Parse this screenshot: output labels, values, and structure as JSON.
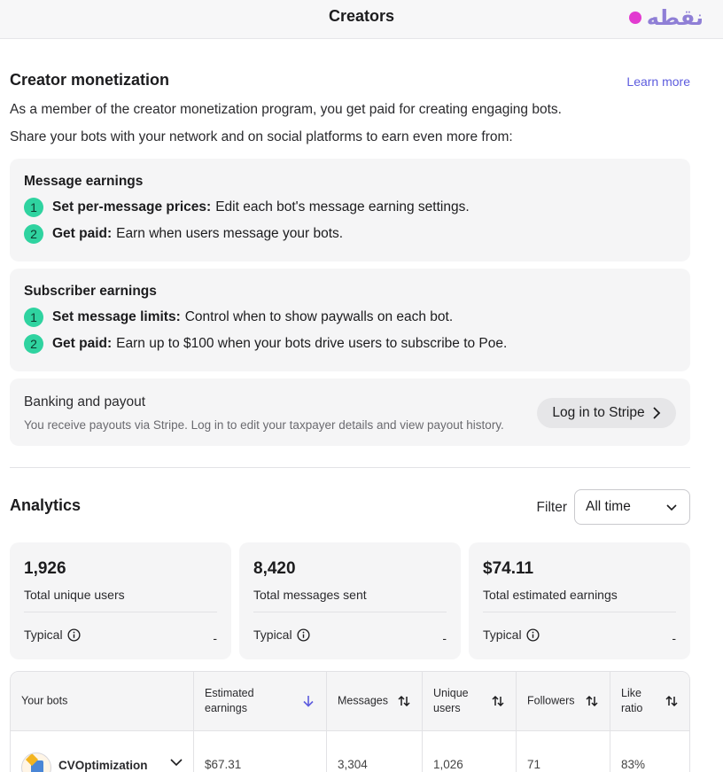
{
  "header": {
    "title": "Creators",
    "watermark": "نقطه"
  },
  "monetization": {
    "title": "Creator monetization",
    "learn_more": "Learn more",
    "intro_1": "As a member of the creator monetization program, you get paid for creating engaging bots.",
    "intro_2": "Share your bots with your network and on social platforms to earn even more from:",
    "message_earnings": {
      "title": "Message earnings",
      "steps": [
        {
          "num": "1",
          "bold": "Set per-message prices:",
          "text": "Edit each bot's message earning settings."
        },
        {
          "num": "2",
          "bold": "Get paid:",
          "text": "Earn when users message your bots."
        }
      ]
    },
    "subscriber_earnings": {
      "title": "Subscriber earnings",
      "steps": [
        {
          "num": "1",
          "bold": "Set message limits:",
          "text": "Control when to show paywalls on each bot."
        },
        {
          "num": "2",
          "bold": "Get paid:",
          "text": "Earn up to $100 when your bots drive users to subscribe to Poe."
        }
      ]
    },
    "banking": {
      "title": "Banking and payout",
      "description": "You receive payouts via Stripe. Log in to edit your taxpayer details and view payout history.",
      "button": "Log in to Stripe"
    }
  },
  "analytics": {
    "title": "Analytics",
    "filter_label": "Filter",
    "filter_value": "All time",
    "stats": [
      {
        "value": "1,926",
        "label": "Total unique users",
        "typical": "Typical",
        "typical_value": "-"
      },
      {
        "value": "8,420",
        "label": "Total messages sent",
        "typical": "Typical",
        "typical_value": "-"
      },
      {
        "value": "$74.11",
        "label": "Total estimated earnings",
        "typical": "Typical",
        "typical_value": "-"
      }
    ],
    "table": {
      "headers": {
        "bots": "Your bots",
        "earnings_1": "Estimated",
        "earnings_2": "earnings",
        "messages": "Messages",
        "unique_1": "Unique",
        "unique_2": "users",
        "followers": "Followers",
        "like_1": "Like",
        "like_2": "ratio"
      },
      "rows": [
        {
          "bot": "CVOptimization",
          "earnings": "$67.31",
          "messages": "3,304",
          "unique_users": "1,026",
          "followers": "71",
          "like_ratio": "83%"
        }
      ]
    },
    "accent_color": "#5d5cde",
    "step_color": "#2fd3a0"
  }
}
